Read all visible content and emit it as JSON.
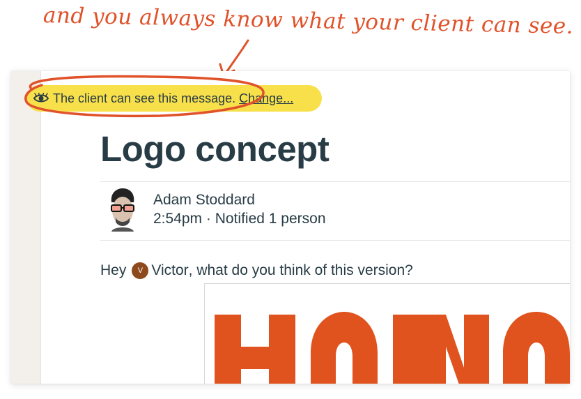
{
  "annotation": {
    "text": "and you always know what your client can see."
  },
  "visibility": {
    "icon": "eye-icon",
    "text": "The client can see this message.",
    "change_label": "Change..."
  },
  "message": {
    "title": "Logo concept",
    "author": {
      "name": "Adam Stoddard",
      "time": "2:54pm",
      "separator": "·",
      "notified": "Notified 1 person"
    },
    "body": {
      "greeting": "Hey",
      "mention_initial": "V",
      "mention_name": "Victor",
      "text": ", what do you think of this version?"
    }
  },
  "colors": {
    "annotation": "#e0522a",
    "pill_background": "#f8e04b",
    "text": "#283c46",
    "logo_orange": "#e0531f",
    "mention_avatar": "#8e4a1d"
  }
}
